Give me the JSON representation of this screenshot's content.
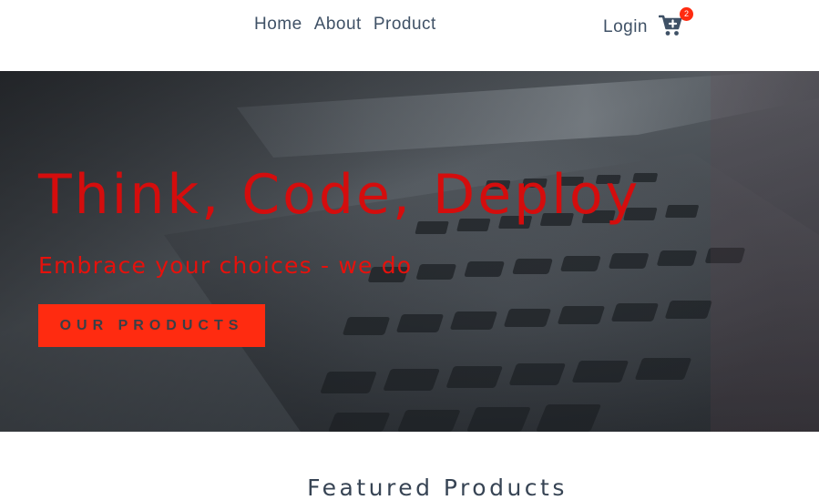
{
  "nav": {
    "items": [
      {
        "label": "Home"
      },
      {
        "label": "About"
      },
      {
        "label": "Product"
      }
    ],
    "login_label": "Login",
    "cart_count": "2"
  },
  "hero": {
    "title": "Think, Code, Deploy",
    "subtitle": "Embrace your choices - we do",
    "button_label": "OUR PRODUCTS"
  },
  "featured": {
    "title": "Featured Products"
  },
  "colors": {
    "accent": "#ff2b10",
    "hero_text": "#d40d0d",
    "nav_text": "#3f5166"
  },
  "icons": {
    "cart": "cart-plus-icon"
  }
}
